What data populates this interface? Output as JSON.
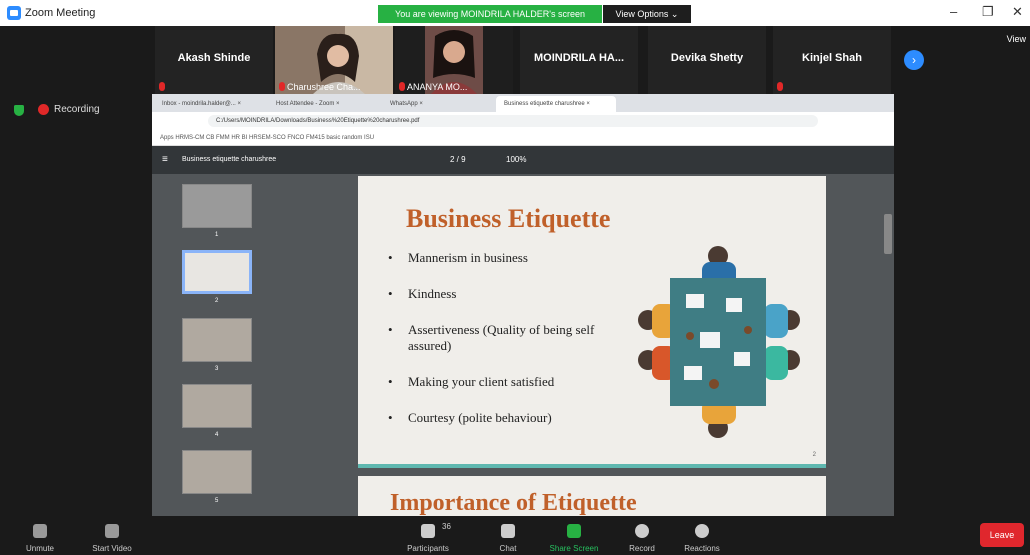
{
  "window": {
    "title": "Zoom Meeting"
  },
  "banner": {
    "text": "You are viewing MOINDRILA HALDER's screen",
    "view_options": "View Options ⌄"
  },
  "controls": {
    "min": "–",
    "restore": "❐",
    "close": "✕"
  },
  "participants": [
    {
      "name": "Akash Shinde",
      "video": false
    },
    {
      "name": "Charushree Cha...",
      "video": true
    },
    {
      "name": "ANANYA MO...",
      "video": true
    },
    {
      "name": "MOINDRILA HA...",
      "video": false
    },
    {
      "name": "Devika Shetty",
      "video": false
    },
    {
      "name": "Kinjel Shah",
      "video": false
    }
  ],
  "view_label": "View",
  "recording": {
    "label": "Recording"
  },
  "browser": {
    "tabs": [
      "Inbox - moindrila.halder@... ×",
      "Host Attendee - Zoom ×",
      "WhatsApp ×",
      "Business etiquette charushree ×"
    ],
    "url": "C:/Users/MOINDRILA/Downloads/Business%20Etiquette%20charushree.pdf",
    "bookmarks": "Apps   HRMS-CM   CB   FMM   HR   BI   HRSEM-SCO   FNCO   FM415   basic random   ISU",
    "pdf_title": "Business etiquette charushree",
    "page": "2 / 9",
    "zoom": "100%",
    "thumb_numbers": [
      "1",
      "2",
      "3",
      "4",
      "5"
    ]
  },
  "slide": {
    "title": "Business Etiquette",
    "bullets": [
      "Mannerism in business",
      "Kindness",
      "Assertiveness (Quality of being self assured)",
      "Making your client satisfied",
      "Courtesy (polite behaviour)"
    ],
    "page_num": "2"
  },
  "slide2": {
    "title": "Importance of Etiquette"
  },
  "toolbar": {
    "unmute": "Unmute",
    "start_video": "Start Video",
    "participants": "Participants",
    "participants_count": "36",
    "chat": "Chat",
    "share": "Share Screen",
    "record": "Record",
    "reactions": "Reactions",
    "leave": "Leave"
  },
  "colors": {
    "green": "#27b143",
    "blue": "#2d8cff",
    "red": "#e02828",
    "title_orange": "#c0602a"
  }
}
